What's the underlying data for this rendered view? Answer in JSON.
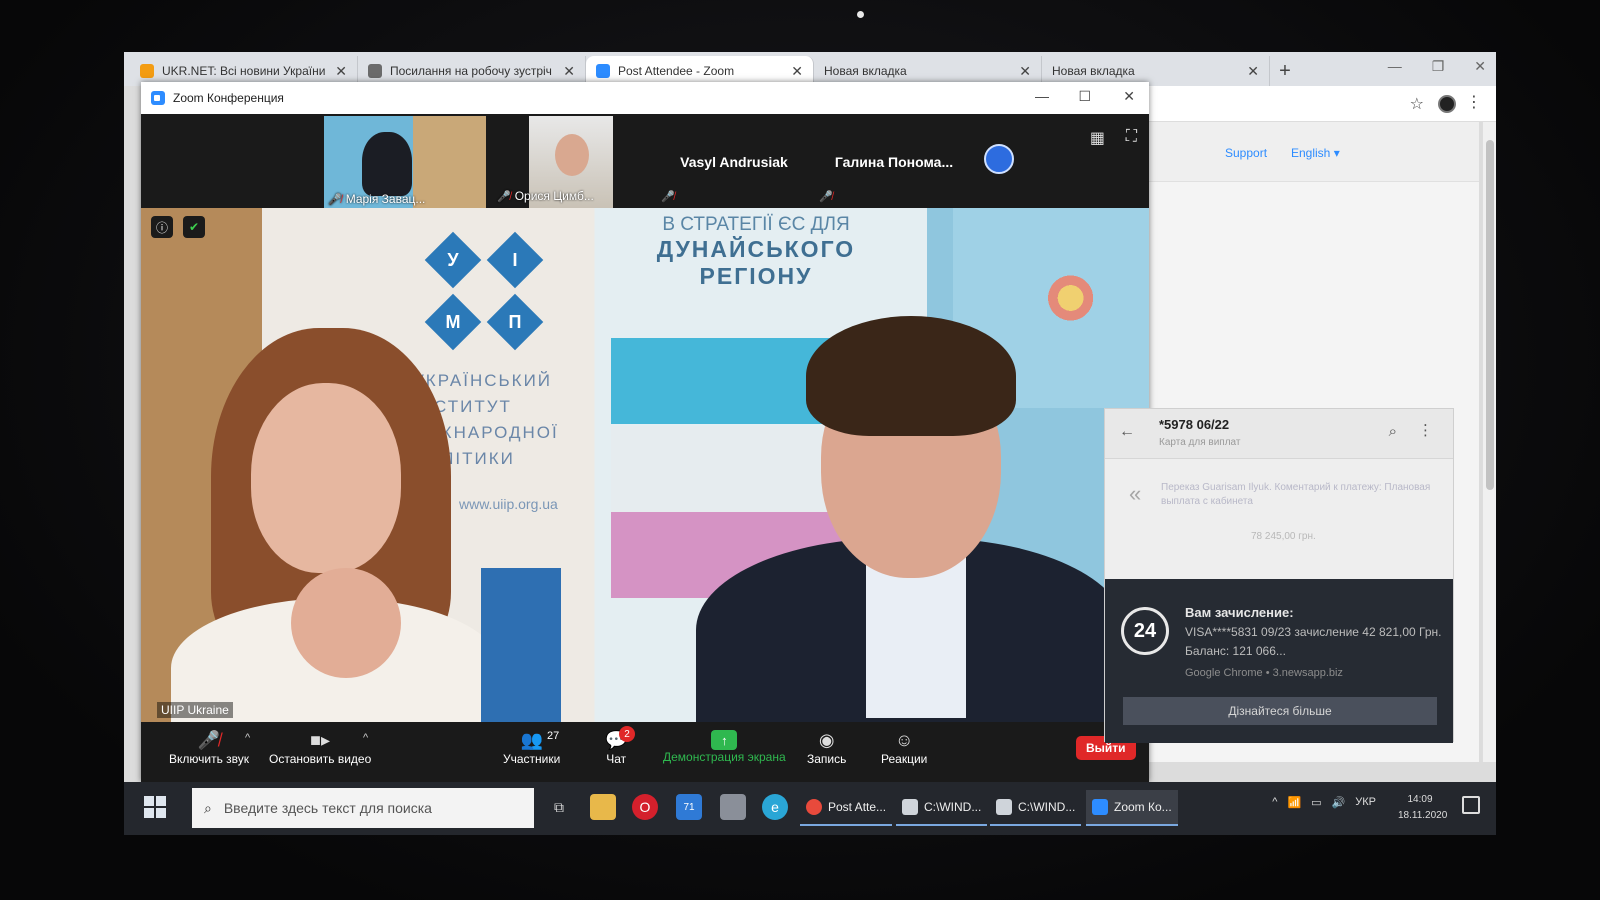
{
  "browser": {
    "tabs": [
      {
        "title": "UKR.NET: Всі новини України",
        "color": "#f39c12"
      },
      {
        "title": "Посилання на робочу зустріч",
        "color": "#6b6b6b"
      },
      {
        "title": "Post Attendee - Zoom",
        "color": "#2d8cff"
      },
      {
        "title": "Новая вкладка",
        "color": "#cccccc"
      },
      {
        "title": "Новая вкладка",
        "color": "#cccccc"
      }
    ],
    "new_tab_icon": "+",
    "support_link": "Support",
    "language_link": "English ▾"
  },
  "zoom": {
    "window_title": "Zoom Конференция",
    "participants_strip": [
      {
        "name": "Марія Завац..."
      },
      {
        "name": "Орися Цимб..."
      },
      {
        "name": "Vasyl Andrusiak"
      },
      {
        "name": "Галина Понома..."
      }
    ],
    "main_video": {
      "speaker_label": "UIIP Ukraine",
      "logo_letters": [
        "У",
        "І",
        "М",
        "П"
      ],
      "institute_lines": [
        "УКРАЇНСЬКИЙ",
        "ІНСТИТУТ",
        "МІЖНАРОДНОЇ",
        "ПОЛІТИКИ"
      ],
      "institute_url": "www.uiip.org.ua",
      "banner_line1": "В СТРАТЕГІЇ ЄС ДЛЯ",
      "banner_line2": "ДУНАЙСЬКОГО",
      "banner_line3": "РЕГІОНУ"
    },
    "toolbar": {
      "mute_label": "Включить звук",
      "video_label": "Остановить видео",
      "participants_label": "Участники",
      "participants_count": "27",
      "chat_label": "Чат",
      "chat_badge": "2",
      "share_label": "Демонстрация экрана",
      "record_label": "Запись",
      "reactions_label": "Реакции",
      "end_label": "Выйти"
    }
  },
  "notification": {
    "card_number": "*5978 06/22",
    "card_subtitle": "Карта для виплат",
    "blurred_text": "Переказ Guarisam Ilyuk. Коментарий к платежу: Плановая выплата с кабинета",
    "blurred_amount": "78 245,00 грн.",
    "toast_logo": "24",
    "toast_title": "Вам зачисление:",
    "toast_body": "VISA****5831 09/23 зачисление 42 821,00 Грн. Баланс: 121 066...",
    "toast_source": "Google Chrome • 3.newsapp.biz",
    "toast_button": "Дізнайтеся більше"
  },
  "taskbar": {
    "search_placeholder": "Введите здесь текст для поиска",
    "mail_badge": "71",
    "apps": [
      {
        "label": "Post Atte..."
      },
      {
        "label": "C:\\WIND..."
      },
      {
        "label": "C:\\WIND..."
      },
      {
        "label": "Zoom Ко..."
      }
    ],
    "language": "УКР",
    "time": "14:09",
    "date": "18.11.2020"
  }
}
